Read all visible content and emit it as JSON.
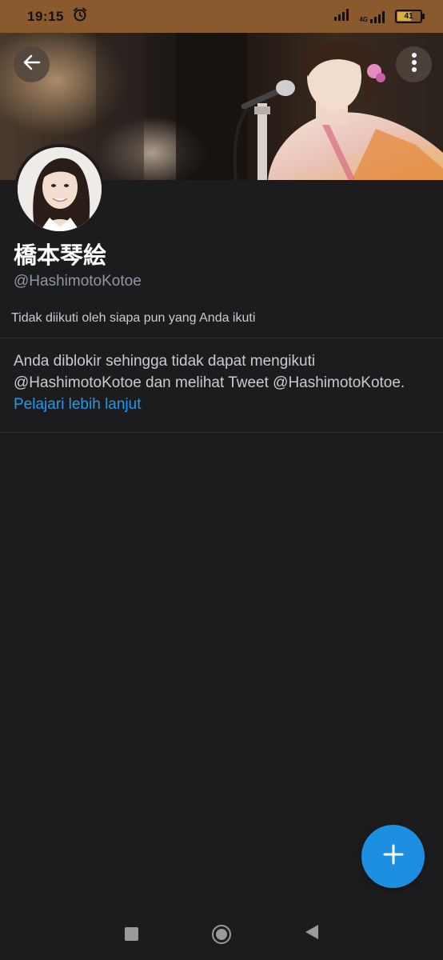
{
  "status_bar": {
    "time": "19:15",
    "network_label": "4G",
    "battery_level": "41",
    "icons": [
      "alarm-icon",
      "signal-icon",
      "signal-4g-icon",
      "battery-icon"
    ]
  },
  "header": {
    "back_icon": "arrow-left-icon",
    "more_icon": "more-vertical-icon"
  },
  "profile": {
    "name": "橋本琴絵",
    "handle": "@HashimotoKotoe",
    "follow_info": "Tidak diikuti oleh siapa pun yang Anda ikuti"
  },
  "blocked_notice": {
    "message": "Anda diblokir sehingga tidak dapat mengikuti @HashimotoKotoe dan melihat Tweet @HashimotoKotoe.",
    "link_label": "Pelajari lebih lanjut"
  },
  "fab": {
    "icon": "plus-icon"
  },
  "android_nav": {
    "icons": [
      "recent-apps-icon",
      "home-icon",
      "back-triangle-icon"
    ]
  },
  "colors": {
    "background": "#1c1c1e",
    "status_bar": "#8a5a2e",
    "accent": "#1d9bf0",
    "fab": "#1d8fe0",
    "secondary_text": "#8b98a5"
  }
}
